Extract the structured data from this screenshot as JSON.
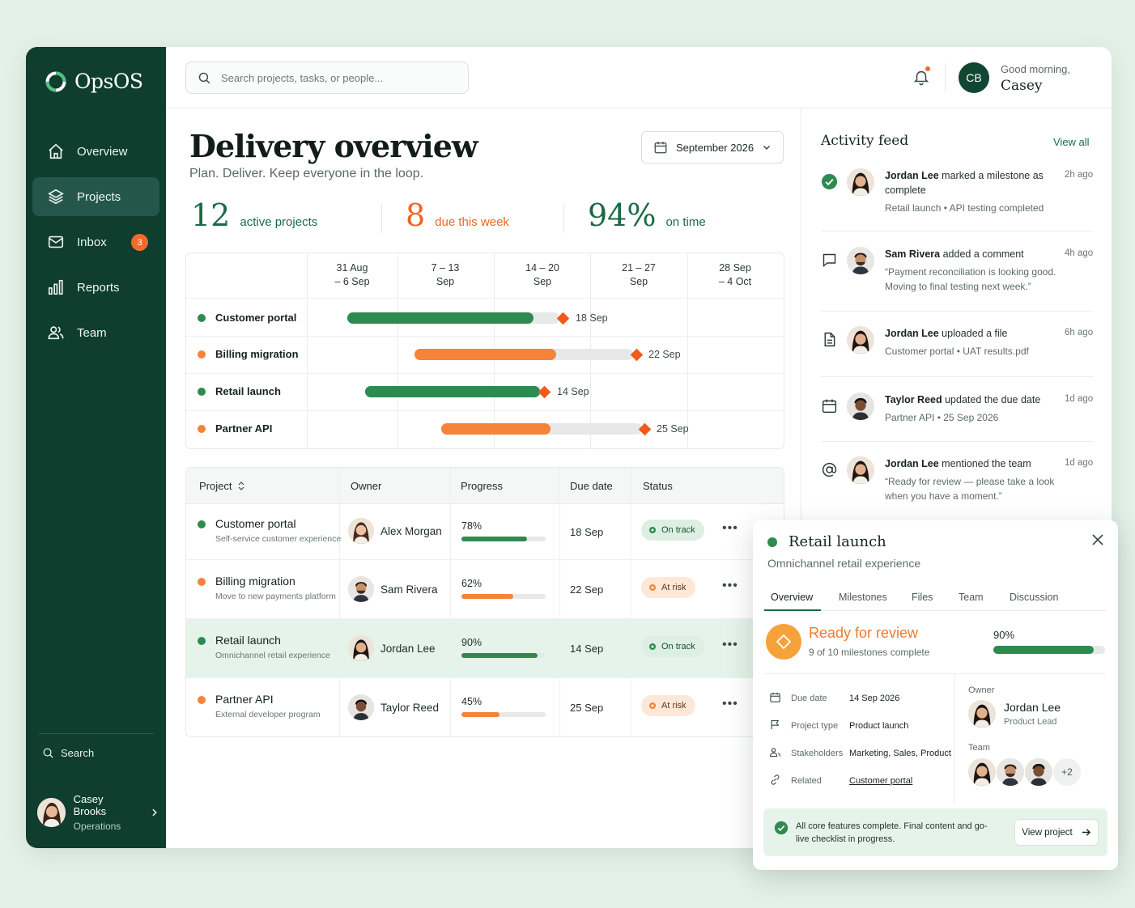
{
  "app": {
    "name": "OpsOS"
  },
  "sidebar": {
    "items": [
      {
        "label": "Overview",
        "icon": "home-icon"
      },
      {
        "label": "Projects",
        "icon": "layers-icon",
        "active": true
      },
      {
        "label": "Inbox",
        "icon": "mail-icon",
        "badge": "3"
      },
      {
        "label": "Reports",
        "icon": "bar-chart-icon"
      },
      {
        "label": "Team",
        "icon": "users-icon"
      }
    ],
    "search_label": "Search",
    "profile": {
      "name": "Casey Brooks",
      "role": "Operations"
    }
  },
  "topbar": {
    "search_placeholder": "Search projects, tasks, or people...",
    "initials": "CB",
    "greeting": "Good morning,",
    "user_first_name": "Casey"
  },
  "page": {
    "title": "Delivery overview",
    "subtitle": "Plan. Deliver. Keep everyone in the loop.",
    "month": "September 2026"
  },
  "stats": [
    {
      "value": "12",
      "label": "active projects",
      "color": "#1a6b45"
    },
    {
      "value": "8",
      "label": "due this week",
      "color": "#f0641f"
    },
    {
      "value": "94%",
      "label": "on time",
      "color": "#1a6b45"
    }
  ],
  "timeline": {
    "weeks": [
      {
        "l1": "31 Aug",
        "l2": "– 6 Sep"
      },
      {
        "l1": "7 – 13",
        "l2": "Sep"
      },
      {
        "l1": "14 – 20",
        "l2": "Sep"
      },
      {
        "l1": "21 – 27",
        "l2": "Sep"
      },
      {
        "l1": "28 Sep",
        "l2": "– 4 Oct"
      }
    ],
    "rows": [
      {
        "name": "Customer portal",
        "color": "#2e8b50",
        "due": "18 Sep"
      },
      {
        "name": "Billing migration",
        "color": "#f5843a",
        "due": "22 Sep"
      },
      {
        "name": "Retail launch",
        "color": "#2e8b50",
        "due": "14 Sep"
      },
      {
        "name": "Partner API",
        "color": "#f5843a",
        "due": "25 Sep"
      }
    ]
  },
  "table": {
    "headers": {
      "project": "Project",
      "owner": "Owner",
      "progress": "Progress",
      "due": "Due date",
      "status": "Status"
    },
    "rows": [
      {
        "name": "Customer portal",
        "desc": "Self-service customer experience",
        "owner": "Alex Morgan",
        "progress": "78%",
        "progress_value": 0.78,
        "due": "18 Sep",
        "status": "On track",
        "color": "#2e8b50"
      },
      {
        "name": "Billing migration",
        "desc": "Move to new payments platform",
        "owner": "Sam Rivera",
        "progress": "62%",
        "progress_value": 0.62,
        "due": "22 Sep",
        "status": "At risk",
        "color": "#f5843a"
      },
      {
        "name": "Retail launch",
        "desc": "Omnichannel retail experience",
        "owner": "Jordan Lee",
        "progress": "90%",
        "progress_value": 0.9,
        "due": "14 Sep",
        "status": "On track",
        "color": "#2e8b50"
      },
      {
        "name": "Partner API",
        "desc": "External developer program",
        "owner": "Taylor Reed",
        "progress": "45%",
        "progress_value": 0.45,
        "due": "25 Sep",
        "status": "At risk",
        "color": "#f5843a"
      }
    ]
  },
  "activity": {
    "title": "Activity feed",
    "view_all": "View all",
    "items": [
      {
        "icon": "check-circle-icon",
        "actor": "Jordan Lee",
        "action": "marked a milestone as complete",
        "detail": "Retail launch  •  API testing completed",
        "time": "2h ago"
      },
      {
        "icon": "comment-icon",
        "actor": "Sam Rivera",
        "action": "added a comment",
        "detail": "“Payment reconciliation is looking good. Moving to final testing next week.”",
        "time": "4h ago"
      },
      {
        "icon": "file-icon",
        "actor": "Jordan Lee",
        "action": "uploaded a file",
        "detail": "Customer portal  •  UAT results.pdf",
        "time": "6h ago"
      },
      {
        "icon": "calendar-icon",
        "actor": "Taylor Reed",
        "action": "updated the due date",
        "detail": "Partner API  •  25 Sep 2026",
        "time": "1d ago"
      },
      {
        "icon": "at-icon",
        "actor": "Jordan Lee",
        "action": "mentioned the team",
        "detail": "“Ready for review — please take a look when you have a moment.”",
        "time": "1d ago"
      }
    ]
  },
  "detail": {
    "title": "Retail launch",
    "subtitle": "Omnichannel retail experience",
    "tabs": [
      "Overview",
      "Milestones",
      "Files",
      "Team",
      "Discussion"
    ],
    "status_title": "Ready for review",
    "status_sub": "9 of 10 milestones complete",
    "progress": "90%",
    "progress_value": 0.9,
    "fields": [
      {
        "icon": "calendar-icon",
        "key": "Due date",
        "value": "14 Sep 2026"
      },
      {
        "icon": "flag-icon",
        "key": "Project type",
        "value": "Product launch"
      },
      {
        "icon": "users-icon",
        "key": "Stakeholders",
        "value": "Marketing, Sales, Product"
      },
      {
        "icon": "link-icon",
        "key": "Related",
        "value": "Customer portal"
      }
    ],
    "owner_label": "Owner",
    "owner_name": "Jordan Lee",
    "owner_role": "Product Lead",
    "team_label": "Team",
    "team_more": "+2",
    "footer_text": "All core features complete. Final content  and go-live checklist in progress.",
    "button": "View project"
  }
}
